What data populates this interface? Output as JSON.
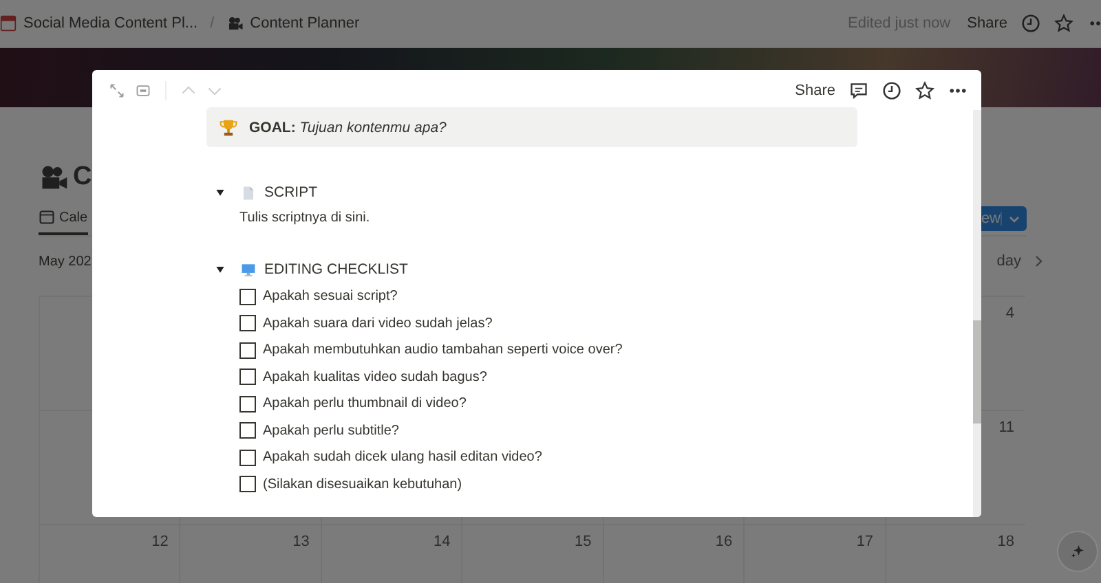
{
  "topbar": {
    "breadcrumbs": [
      {
        "text": "Social Media Content Pl..."
      },
      {
        "text": "Content Planner"
      }
    ],
    "separator": "/",
    "edited": "Edited just now",
    "share": "Share"
  },
  "page": {
    "title": "C",
    "tab": "Cale",
    "month": "May 202",
    "new_button": "ew",
    "today": "day",
    "calendar": {
      "rows": [
        {
          "days": [
            "4"
          ]
        },
        {
          "days": [
            "11"
          ]
        },
        {
          "days": [
            "12",
            "13",
            "14",
            "15",
            "16",
            "17",
            "18"
          ]
        }
      ]
    }
  },
  "modal": {
    "share": "Share",
    "goal": "**GOAL:** *Tujuan kontenmu apa?*",
    "toggles": [
      {
        "kind": "text",
        "title": "SCRIPT",
        "expanded": true,
        "body": "Tulis scriptnya di sini."
      },
      {
        "kind": "checklist",
        "title": "EDITING CHECKLIST",
        "expanded": true,
        "items": [
          {
            "label": "Apakah sesuai script?",
            "checked": false
          },
          {
            "label": "Apakah suara dari video sudah jelas?",
            "checked": false
          },
          {
            "label": "Apakah membutuhkan audio tambahan seperti voice over?",
            "checked": false
          },
          {
            "label": "Apakah kualitas video sudah bagus?",
            "checked": false
          },
          {
            "label": "Apakah perlu thumbnail di video?",
            "checked": false
          },
          {
            "label": "Apakah perlu subtitle?",
            "checked": false
          },
          {
            "label": "Apakah sudah dicek ulang hasil editan video?",
            "checked": false
          },
          {
            "label": "(Silakan disesuaikan kebutuhan)",
            "checked": false
          }
        ]
      }
    ]
  }
}
